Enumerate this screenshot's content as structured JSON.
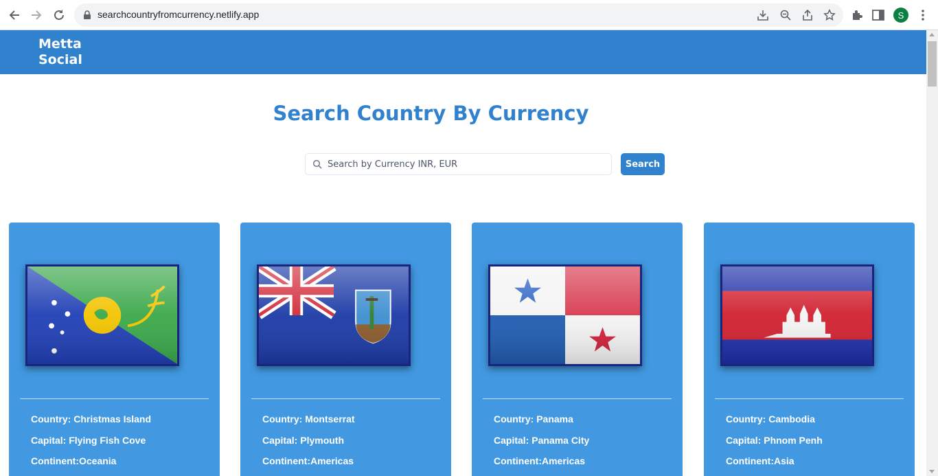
{
  "browser": {
    "url": "searchcountryfromcurrency.netlify.app",
    "profile_initial": "S"
  },
  "header": {
    "brand_line1": "Metta",
    "brand_line2": "Social",
    "accent_color": "#3182ce"
  },
  "main": {
    "title": "Search Country By Currency",
    "search_placeholder": "Search by Currency INR, EUR",
    "search_value": "",
    "search_button": "Search"
  },
  "cards": [
    {
      "flag_icon": "christmas-island-flag-icon",
      "country": "Country: Christmas Island",
      "capital": "Capital: Flying Fish Cove",
      "continent": "Continent:Oceania"
    },
    {
      "flag_icon": "montserrat-flag-icon",
      "country": "Country: Montserrat",
      "capital": "Capital: Plymouth",
      "continent": "Continent:Americas"
    },
    {
      "flag_icon": "panama-flag-icon",
      "country": "Country: Panama",
      "capital": "Capital: Panama City",
      "continent": "Continent:Americas"
    },
    {
      "flag_icon": "cambodia-flag-icon",
      "country": "Country: Cambodia",
      "capital": "Capital: Phnom Penh",
      "continent": "Continent:Asia"
    }
  ]
}
